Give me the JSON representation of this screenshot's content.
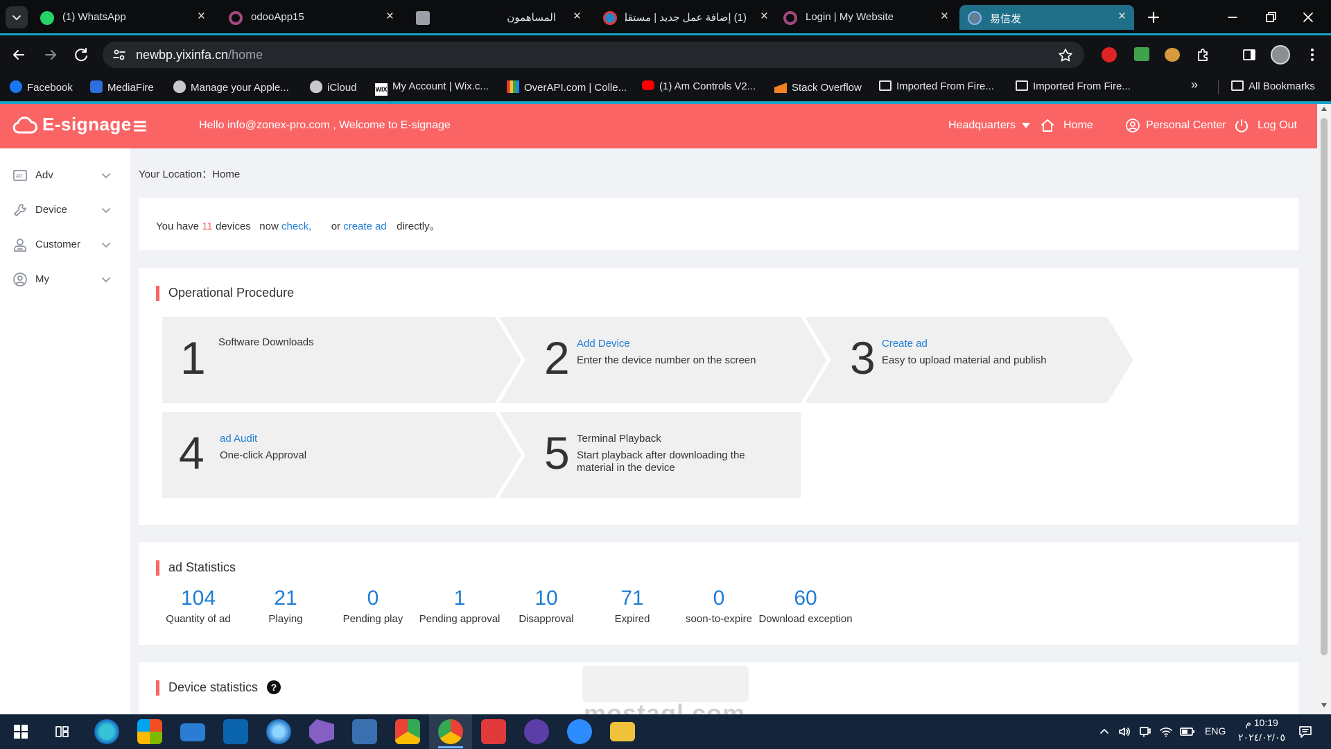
{
  "browser": {
    "tabs": [
      {
        "title": "(1) WhatsApp",
        "icon": "whatsapp-icon",
        "color": "#25d366"
      },
      {
        "title": "odooApp15",
        "icon": "odoo-icon",
        "color": "#a3477f"
      },
      {
        "title": "المساهمون",
        "icon": "app-icon",
        "color": "#9aa0a6"
      },
      {
        "title": "(1) إضافة عمل جديد | مستقل",
        "icon": "mostaql-icon",
        "color": "#2386c8"
      },
      {
        "title": "Login | My Website",
        "icon": "odoo-icon",
        "color": "#a3477f"
      },
      {
        "title": "易信发",
        "icon": "globe-icon",
        "color": "#8ab4f8",
        "active": true
      }
    ],
    "url_host": "newbp.yixinfa.cn",
    "url_path": "/home",
    "bookmarks": [
      {
        "label": "Facebook",
        "icon": "facebook-icon"
      },
      {
        "label": "MediaFire",
        "icon": "mediafire-icon"
      },
      {
        "label": "Manage your Apple...",
        "icon": "apple-icon"
      },
      {
        "label": "iCloud",
        "icon": "apple-icon"
      },
      {
        "label": "My Account | Wix.c...",
        "icon": "wix-icon"
      },
      {
        "label": "OverAPI.com | Colle...",
        "icon": "overapi-icon"
      },
      {
        "label": "(1) Am Controls V2...",
        "icon": "youtube-icon"
      },
      {
        "label": "Stack Overflow",
        "icon": "stackoverflow-icon"
      },
      {
        "label": "Imported From Fire...",
        "icon": "folder-icon"
      },
      {
        "label": "Imported From Fire...",
        "icon": "folder-icon"
      }
    ],
    "all_bookmarks": "All Bookmarks",
    "more_bookmarks": "»"
  },
  "header": {
    "logo": "E-signage",
    "welcome": "Hello   info@zonex-pro.com , Welcome to E-signage",
    "org": "Headquarters",
    "home": "Home",
    "personal_center": "Personal Center",
    "logout": "Log Out",
    "bg_color": "#fa6465"
  },
  "sidebar": {
    "items": [
      {
        "label": "Adv",
        "icon": "ad-icon"
      },
      {
        "label": "Device",
        "icon": "wrench-icon"
      },
      {
        "label": "Customer",
        "icon": "customer-icon"
      },
      {
        "label": "My",
        "icon": "user-circle-icon"
      }
    ]
  },
  "breadcrumb": "Your Location：Home",
  "notice": {
    "prefix": "You have",
    "count": "11",
    "mid": "devices   now",
    "check": "check,",
    "or": "or",
    "create": "create ad",
    "suffix": "directly。"
  },
  "procedure": {
    "title": "Operational Procedure",
    "steps": [
      {
        "num": "1",
        "title": "Software Downloads",
        "desc": ""
      },
      {
        "num": "2",
        "title": "Add Device",
        "desc": "Enter the device number on the screen"
      },
      {
        "num": "3",
        "title": "Create ad",
        "desc": "Easy to upload material and publish"
      },
      {
        "num": "4",
        "title": "ad Audit",
        "desc": "One-click Approval"
      },
      {
        "num": "5",
        "title": "Terminal Playback",
        "desc": "Start playback after downloading the material in the device"
      }
    ]
  },
  "ad_stats": {
    "title": "ad Statistics",
    "items": [
      {
        "value": "104",
        "label": "Quantity of ad"
      },
      {
        "value": "21",
        "label": "Playing"
      },
      {
        "value": "0",
        "label": "Pending play"
      },
      {
        "value": "1",
        "label": "Pending approval"
      },
      {
        "value": "10",
        "label": "Disapproval"
      },
      {
        "value": "71",
        "label": "Expired"
      },
      {
        "value": "0",
        "label": "soon-to-expire"
      },
      {
        "value": "60",
        "label": "Download exception"
      }
    ]
  },
  "device_stats": {
    "title": "Device statistics",
    "help": "?"
  },
  "watermark": "mostaql.com",
  "taskbar": {
    "lang": "ENG",
    "time": "10:19 م",
    "date": "٢٠٢٤/٠٢/٠٥"
  }
}
